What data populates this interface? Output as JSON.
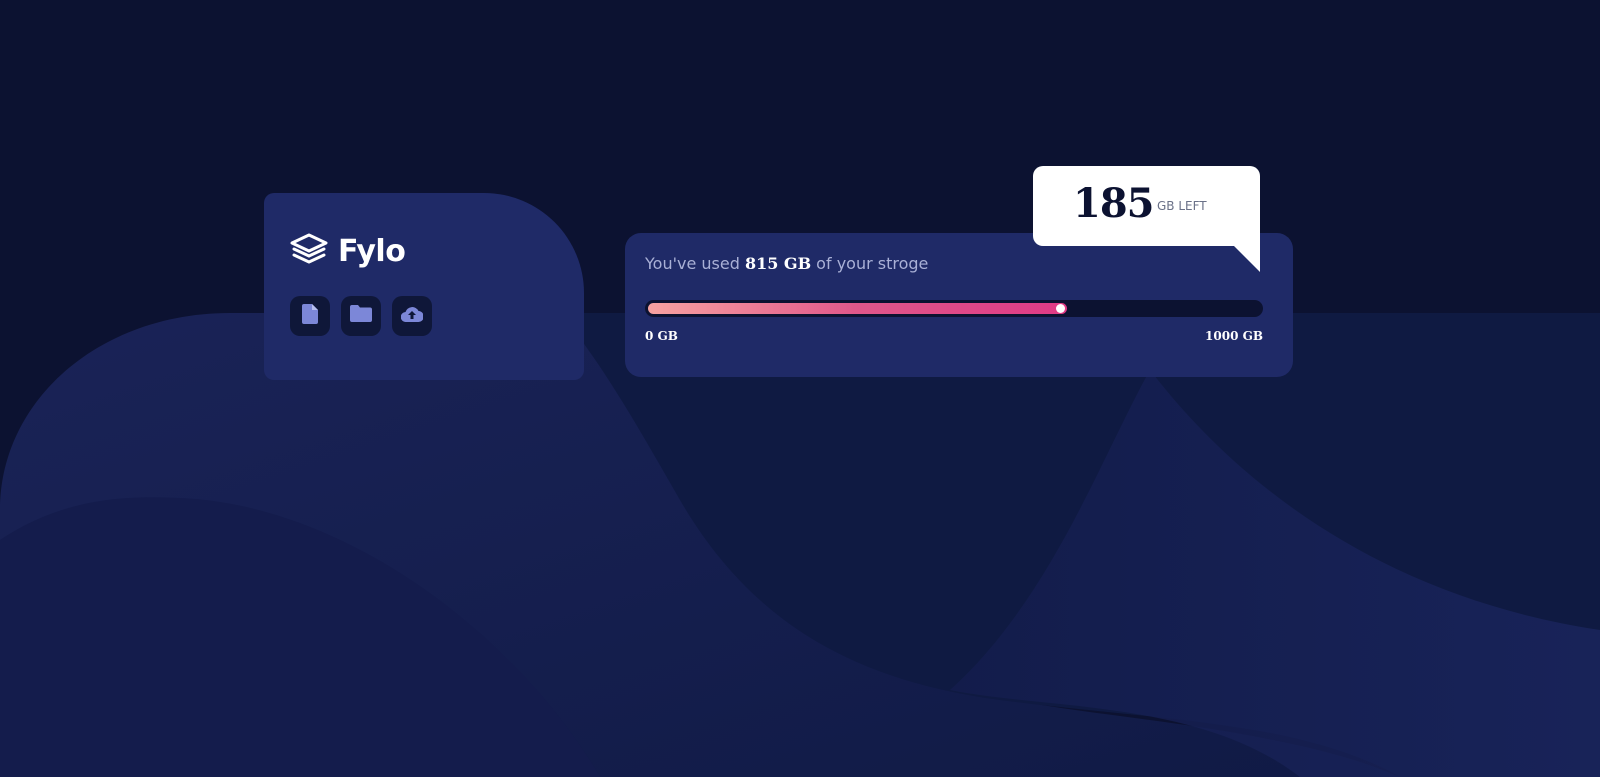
{
  "brand": {
    "name": "Fylo",
    "logo_icon": "layers-icon"
  },
  "icons": [
    {
      "name": "document-icon"
    },
    {
      "name": "folder-icon"
    },
    {
      "name": "cloud-upload-icon"
    }
  ],
  "usage": {
    "prefix": "You've used ",
    "used": "815 GB",
    "suffix": " of your stroge",
    "fraction_used": 0.685,
    "min_label": "0 GB",
    "max_label": "1000 GB"
  },
  "callout": {
    "remaining": "185",
    "unit": "GB LEFT"
  },
  "colors": {
    "background": "#0c1231",
    "card": "#1f2a67",
    "icon": "#7c87d8",
    "bar_start": "#f7a2a1",
    "bar_end": "#e03a86"
  }
}
